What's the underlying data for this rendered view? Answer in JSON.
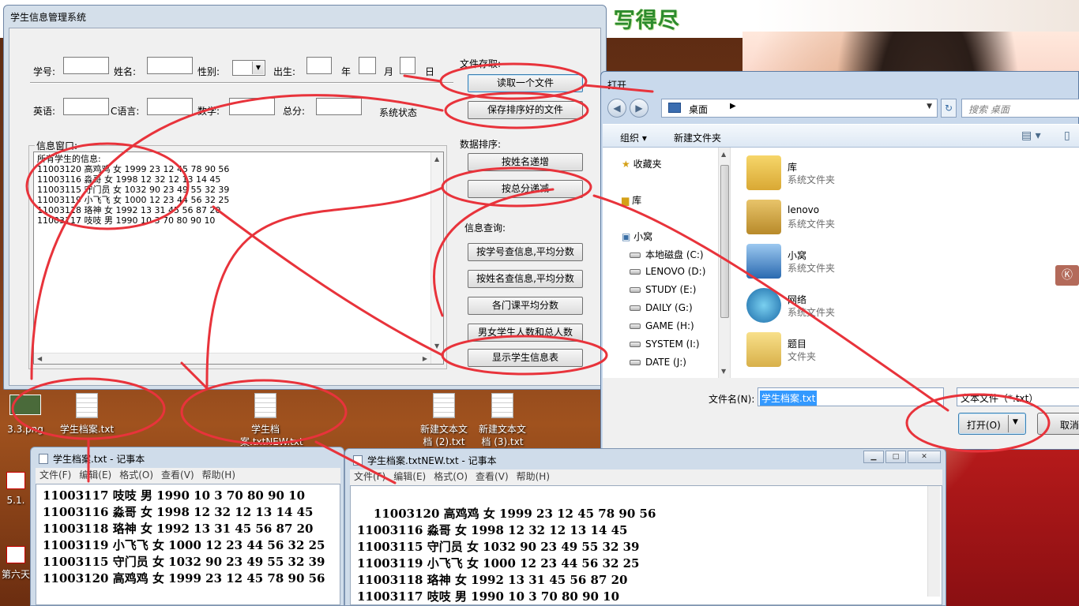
{
  "banner": {
    "lyric": "对我的深情 怎能用只字片语 写得尽"
  },
  "app": {
    "title": "学生信息管理系统",
    "labels": {
      "id": "学号:",
      "name": "姓名:",
      "gender": "性别:",
      "birth": "出生:",
      "year": "年",
      "month": "月",
      "day": "日",
      "english": "英语:",
      "c_lang": "C语言:",
      "math": "数学:",
      "total": "总分:",
      "status": "系统状态",
      "file_io": "文件存取:",
      "sort": "数据排序:",
      "query": "信息查询:",
      "info_window": "信息窗口:"
    },
    "buttons": {
      "read_file": "读取一个文件",
      "save_sorted": "保存排序好的文件",
      "sort_by_name": "按姓名递增",
      "sort_by_total": "按总分递减",
      "query_by_id": "按学号查信息,平均分数",
      "query_by_name": "按姓名查信息,平均分数",
      "course_avg": "各门课平均分数",
      "gender_count": "男女学生人数和总人数",
      "show_table": "显示学生信息表"
    },
    "info_text": "所有学生的信息:\n11003120 高鸡鸡 女 1999 23 12 45 78 90 56\n11003116 淼哥 女 1998 12 32 12 13 14 45\n11003115 守门员 女 1032 90 23 49 55 32 39\n11003119 小飞飞 女 1000 12 23 44 56 32 25\n11003118 珞神 女 1992 13 31 45 56 87 20\n11003117 吱吱 男 1990 10 3 70 80 90 10"
  },
  "dialog": {
    "title": "打开",
    "address": "桌面",
    "search_placeholder": "搜索 桌面",
    "toolbar": {
      "organize": "组织 ▾",
      "new_folder": "新建文件夹"
    },
    "nav": {
      "favorites": "收藏夹",
      "libraries": "库",
      "computer": "小窝",
      "drives": [
        "本地磁盘 (C:)",
        "LENOVO (D:)",
        "STUDY (E:)",
        "DAILY (G:)",
        "GAME (H:)",
        "SYSTEM (I:)",
        "DATE (J:)"
      ]
    },
    "files": [
      {
        "name": "库",
        "type": "系统文件夹"
      },
      {
        "name": "lenovo",
        "type": "系统文件夹"
      },
      {
        "name": "小窝",
        "type": "系统文件夹"
      },
      {
        "name": "网络",
        "type": "系统文件夹"
      },
      {
        "name": "题目",
        "type": "文件夹"
      }
    ],
    "filename_label": "文件名(N):",
    "filename_value": "学生档案.txt",
    "filetype": "文本文件（*.txt）",
    "open_label": "打开(O)",
    "cancel_label": "取消"
  },
  "desktop": {
    "icons": [
      "3.3.png",
      "学生档案.txt",
      "学生档案.txtNEW.txt",
      "新建文本文档 (2).txt",
      "新建文本文档 (3).txt",
      "5.1.",
      "第六天"
    ]
  },
  "notepad1": {
    "title": "学生档案.txt - 记事本",
    "menu": [
      "文件(F)",
      "编辑(E)",
      "格式(O)",
      "查看(V)",
      "帮助(H)"
    ],
    "content": "11003117 吱吱 男 1990 10 3 70 80 90 10\n11003116 淼哥 女 1998 12 32 12 13 14 45\n11003118 珞神 女 1992 13 31 45 56 87 20\n11003119 小飞飞 女 1000 12 23 44 56 32 25\n11003115 守门员 女 1032 90 23 49 55 32 39\n11003120 高鸡鸡 女 1999 23 12 45 78 90 56"
  },
  "notepad2": {
    "title": "学生档案.txtNEW.txt - 记事本",
    "menu": [
      "文件(F)",
      "编辑(E)",
      "格式(O)",
      "查看(V)",
      "帮助(H)"
    ],
    "content": "11003120 高鸡鸡 女 1999 23 12 45 78 90 56\n11003116 淼哥 女 1998 12 32 12 13 14 45\n11003115 守门员 女 1032 90 23 49 55 32 39\n11003119 小飞飞 女 1000 12 23 44 56 32 25\n11003118 珞神 女 1992 13 31 45 56 87 20\n11003117 吱吱 男 1990 10 3 70 80 90 10"
  },
  "colors": {
    "annotation": "#e8333b",
    "lyric": "#2d8b2d",
    "selection": "#3399ff"
  }
}
